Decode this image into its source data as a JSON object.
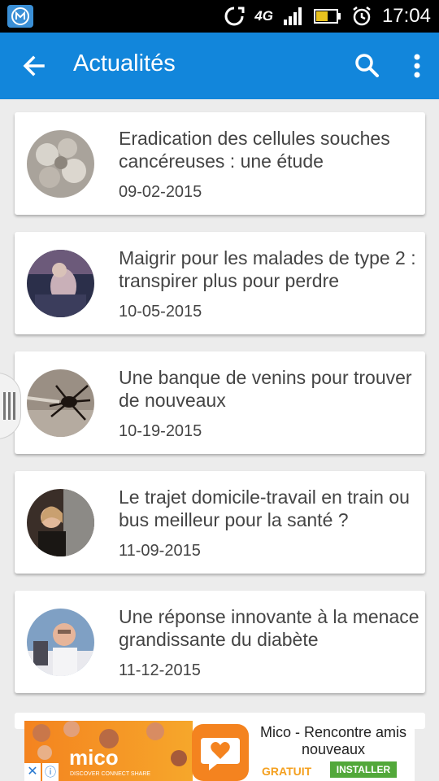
{
  "status_bar": {
    "network": "4G",
    "time": "17:04"
  },
  "app_bar": {
    "title": "Actualités"
  },
  "news": [
    {
      "title": "Eradication des cellules souches cancéreuses : une étude",
      "date": "09-02-2015"
    },
    {
      "title": "Maigrir pour les malades de type 2 : transpirer plus pour perdre",
      "date": "10-05-2015"
    },
    {
      "title": "Une banque de venins pour trouver de nouveaux",
      "date": "10-19-2015"
    },
    {
      "title": "Le trajet domicile-travail en train ou bus meilleur pour la santé ?",
      "date": "11-09-2015"
    },
    {
      "title": "Une réponse innovante à la menace grandissante du diabète",
      "date": "11-12-2015"
    }
  ],
  "ad": {
    "brand": "mico",
    "tagline": "DISCOVER  CONNECT  SHARE",
    "title": "Mico - Rencontre amis nouveaux",
    "price": "GRATUIT",
    "install_label": "INSTALLER",
    "close_glyph": "✕",
    "info_glyph": "ⓘ"
  },
  "colors": {
    "app_bar": "#1286db",
    "background": "#ececec",
    "ad_orange": "#f4831f",
    "install_green": "#52a83a"
  }
}
